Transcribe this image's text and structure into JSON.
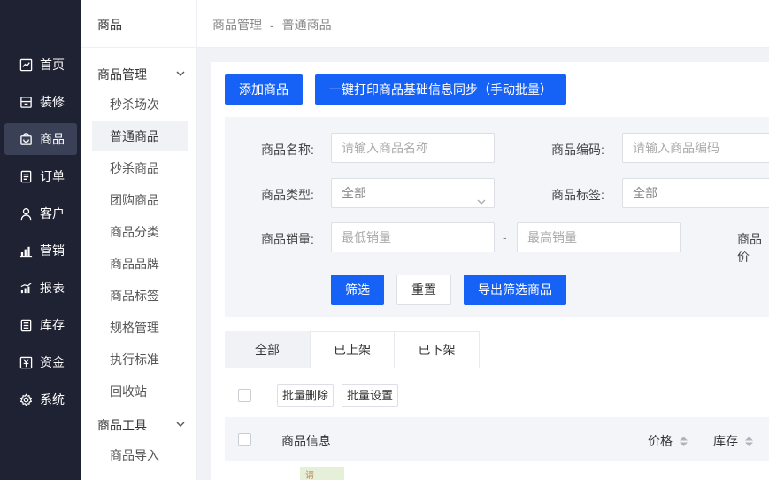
{
  "nav": {
    "items": [
      {
        "label": "首页",
        "icon": "chart-line-icon"
      },
      {
        "label": "装修",
        "icon": "store-icon"
      },
      {
        "label": "商品",
        "icon": "bag-icon",
        "active": true
      },
      {
        "label": "订单",
        "icon": "order-list-icon"
      },
      {
        "label": "客户",
        "icon": "user-icon"
      },
      {
        "label": "营销",
        "icon": "bar-chart-icon"
      },
      {
        "label": "报表",
        "icon": "report-chart-icon"
      },
      {
        "label": "库存",
        "icon": "inventory-icon"
      },
      {
        "label": "资金",
        "icon": "yen-icon"
      },
      {
        "label": "系统",
        "icon": "gear-icon"
      }
    ]
  },
  "submenu": {
    "title": "商品",
    "groups": [
      {
        "label": "商品管理",
        "items": [
          "秒杀场次",
          "普通商品",
          "秒杀商品",
          "团购商品",
          "商品分类",
          "商品品牌",
          "商品标签",
          "规格管理",
          "执行标准",
          "回收站"
        ]
      },
      {
        "label": "商品工具",
        "items": [
          "商品导入"
        ]
      }
    ],
    "active_item": "普通商品"
  },
  "breadcrumb": {
    "first": "商品管理",
    "separator": "-",
    "second": "普通商品"
  },
  "actions": {
    "add": "添加商品",
    "sync": "一键打印商品基础信息同步（手动批量）"
  },
  "filters": {
    "name_label": "商品名称:",
    "name_placeholder": "请输入商品名称",
    "code_label": "商品编码:",
    "code_placeholder": "请输入商品编码",
    "type_label": "商品类型:",
    "type_value": "全部",
    "tag_label": "商品标签:",
    "tag_value": "全部",
    "sales_label": "商品销量:",
    "sales_min_placeholder": "最低销量",
    "sales_dash": "-",
    "sales_max_placeholder": "最高销量",
    "price_label_partial": "商品价",
    "filter_btn": "筛选",
    "reset_btn": "重置",
    "export_btn": "导出筛选商品"
  },
  "tabs": [
    "全部",
    "已上架",
    "已下架"
  ],
  "bulk": {
    "delete": "批量删除",
    "settings": "批量设置"
  },
  "table": {
    "col_info": "商品信息",
    "col_price": "价格",
    "col_stock": "库存"
  },
  "thumb_text": "请"
}
